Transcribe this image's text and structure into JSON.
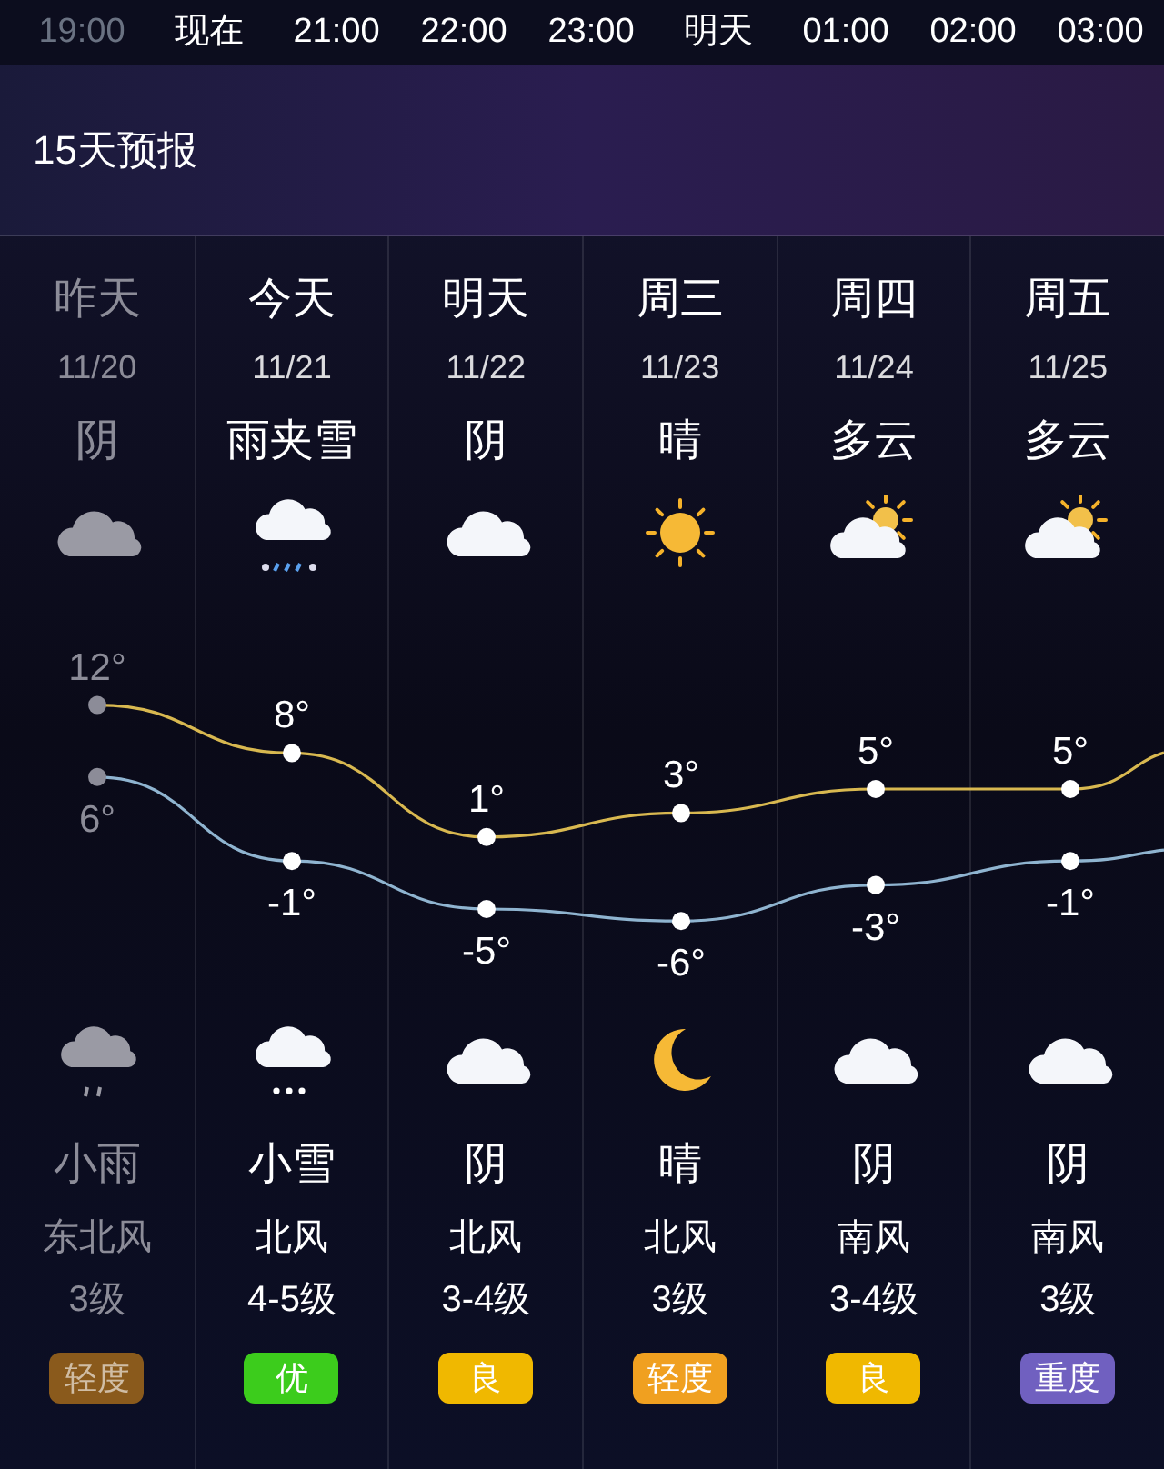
{
  "hourly_bar": [
    {
      "label": "19:00",
      "past": true
    },
    {
      "label": "现在",
      "past": false
    },
    {
      "label": "21:00",
      "past": false
    },
    {
      "label": "22:00",
      "past": false
    },
    {
      "label": "23:00",
      "past": false
    },
    {
      "label": "明天",
      "past": false
    },
    {
      "label": "01:00",
      "past": false
    },
    {
      "label": "02:00",
      "past": false
    },
    {
      "label": "03:00",
      "past": false
    }
  ],
  "section_title": "15天预报",
  "days": [
    {
      "name": "昨天",
      "date": "11/20",
      "past": true,
      "day_weather": {
        "kind": "overcast",
        "condition": "阴"
      },
      "high": "12°",
      "low": "6°",
      "night_weather": {
        "kind": "rain",
        "condition": "小雨"
      },
      "wind": "东北风",
      "wind_level": "3级",
      "air_quality": {
        "label": "轻度",
        "color": "#8a5a1c"
      }
    },
    {
      "name": "今天",
      "date": "11/21",
      "past": false,
      "day_weather": {
        "kind": "sleet",
        "condition": "雨夹雪"
      },
      "high": "8°",
      "low": "-1°",
      "night_weather": {
        "kind": "snow",
        "condition": "小雪"
      },
      "wind": "北风",
      "wind_level": "4-5级",
      "air_quality": {
        "label": "优",
        "color": "#3ccc1c"
      }
    },
    {
      "name": "明天",
      "date": "11/22",
      "past": false,
      "day_weather": {
        "kind": "cloudy",
        "condition": "阴"
      },
      "high": "1°",
      "low": "-5°",
      "night_weather": {
        "kind": "cloudy",
        "condition": "阴"
      },
      "wind": "北风",
      "wind_level": "3-4级",
      "air_quality": {
        "label": "良",
        "color": "#f0b800"
      }
    },
    {
      "name": "周三",
      "date": "11/23",
      "past": false,
      "day_weather": {
        "kind": "sunny",
        "condition": "晴"
      },
      "high": "3°",
      "low": "-6°",
      "night_weather": {
        "kind": "moon",
        "condition": "晴"
      },
      "wind": "北风",
      "wind_level": "3级",
      "air_quality": {
        "label": "轻度",
        "color": "#f0a020"
      }
    },
    {
      "name": "周四",
      "date": "11/24",
      "past": false,
      "day_weather": {
        "kind": "partly-cloudy",
        "condition": "多云"
      },
      "high": "5°",
      "low": "-3°",
      "night_weather": {
        "kind": "cloudy",
        "condition": "阴"
      },
      "wind": "南风",
      "wind_level": "3-4级",
      "air_quality": {
        "label": "良",
        "color": "#f0b800"
      }
    },
    {
      "name": "周五",
      "date": "11/25",
      "past": false,
      "day_weather": {
        "kind": "partly-cloudy",
        "condition": "多云"
      },
      "high": "5°",
      "low": "-1°",
      "night_weather": {
        "kind": "cloudy",
        "condition": "阴"
      },
      "wind": "南风",
      "wind_level": "3级",
      "air_quality": {
        "label": "重度",
        "color": "#7060c0"
      }
    }
  ]
}
